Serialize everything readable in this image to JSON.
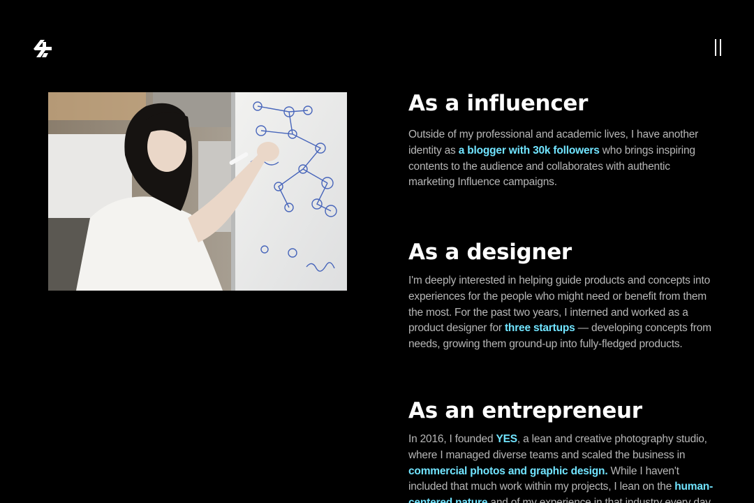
{
  "header": {
    "logo_icon": "monogram-logo-icon",
    "menu_icon": "pause-menu-icon"
  },
  "photo": {
    "description_icon": "photo-woman-whiteboard"
  },
  "influencer": {
    "title": "As a influencer",
    "text_1": "Outside of my professional and academic lives, I have another identity as ",
    "highlight_1": "a blogger with 30k followers",
    "text_2": " who brings inspiring contents to the audience and collaborates with authentic marketing Influence campaigns."
  },
  "designer": {
    "title": "As a designer",
    "text_1": "I'm deeply interested in helping guide products and concepts into experiences for the people who might need or benefit from them the most. For the past two years, I interned and worked as a product designer for ",
    "highlight_1": "three startups",
    "text_2": " — developing concepts from needs, growing them ground-up into fully-fledged products."
  },
  "entrepreneur": {
    "title": "As an entrepreneur",
    "text_1": "In 2016, I founded ",
    "highlight_1": "YES",
    "text_2": ", a lean and creative photography studio, where I managed diverse teams and scaled the business in ",
    "highlight_2": "commercial photos and graphic design.",
    "text_3": " While I haven't included that much work within my projects, I lean on the ",
    "highlight_3": "human-centered nature",
    "text_4": " and of my experience in that industry every day."
  },
  "colors": {
    "background": "#000000",
    "accent": "#71e4ff",
    "body_text": "#b7b7b7"
  }
}
